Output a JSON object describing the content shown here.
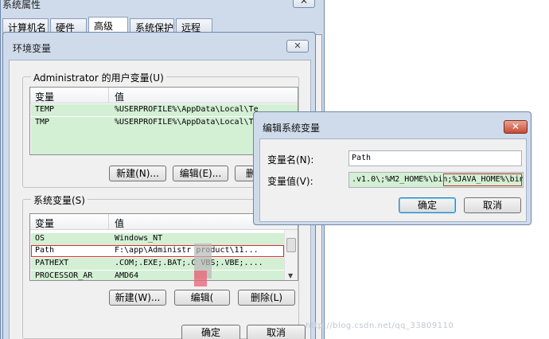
{
  "system_properties": {
    "title": "系统属性",
    "close_label": "✕",
    "tabs": [
      "计算机名",
      "硬件",
      "高级",
      "系统保护",
      "远程"
    ],
    "active_tab": "高级"
  },
  "env_dialog": {
    "title": "环境变量",
    "close_label": "✕",
    "user_group_label": "Administrator 的用户变量(U)",
    "user_columns": [
      "变量",
      "值"
    ],
    "user_vars": [
      {
        "name": "TEMP",
        "value": "%USERPROFILE%\\AppData\\Local\\Te"
      },
      {
        "name": "TMP",
        "value": "%USERPROFILE%\\AppData\\Local\\Te"
      }
    ],
    "user_buttons": {
      "new": "新建(N)...",
      "edit": "编辑(E)...",
      "delete": "删"
    },
    "system_group_label": "系统变量(S)",
    "system_columns": [
      "变量",
      "值"
    ],
    "system_vars": [
      {
        "name": "OS",
        "value": "Windows_NT"
      },
      {
        "name": "Path",
        "value": "F:\\app\\Administr    product\\11..."
      },
      {
        "name": "PATHEXT",
        "value": ".COM;.EXE;.BAT;.C     VBS;.VBE;...."
      },
      {
        "name": "PROCESSOR_AR",
        "value": "AMD64"
      }
    ],
    "system_buttons": {
      "new": "新建(W)...",
      "edit": "编辑(",
      "delete": "删除(L)"
    },
    "ok_label": "确定",
    "cancel_label": "取消"
  },
  "edit_dialog": {
    "title": "编辑系统变量",
    "close_label": "✕",
    "name_label": "变量名(N):",
    "name_value": "Path",
    "value_label": "变量值(V):",
    "value_text_a": ".v1.0\\;%M2_HOME%\\bin;",
    "value_text_b": "%JAVA_HOME%\\bin",
    "ok_label": "确定",
    "cancel_label": "取消"
  },
  "watermark": "http://blog.csdn.net/qq_33809110"
}
